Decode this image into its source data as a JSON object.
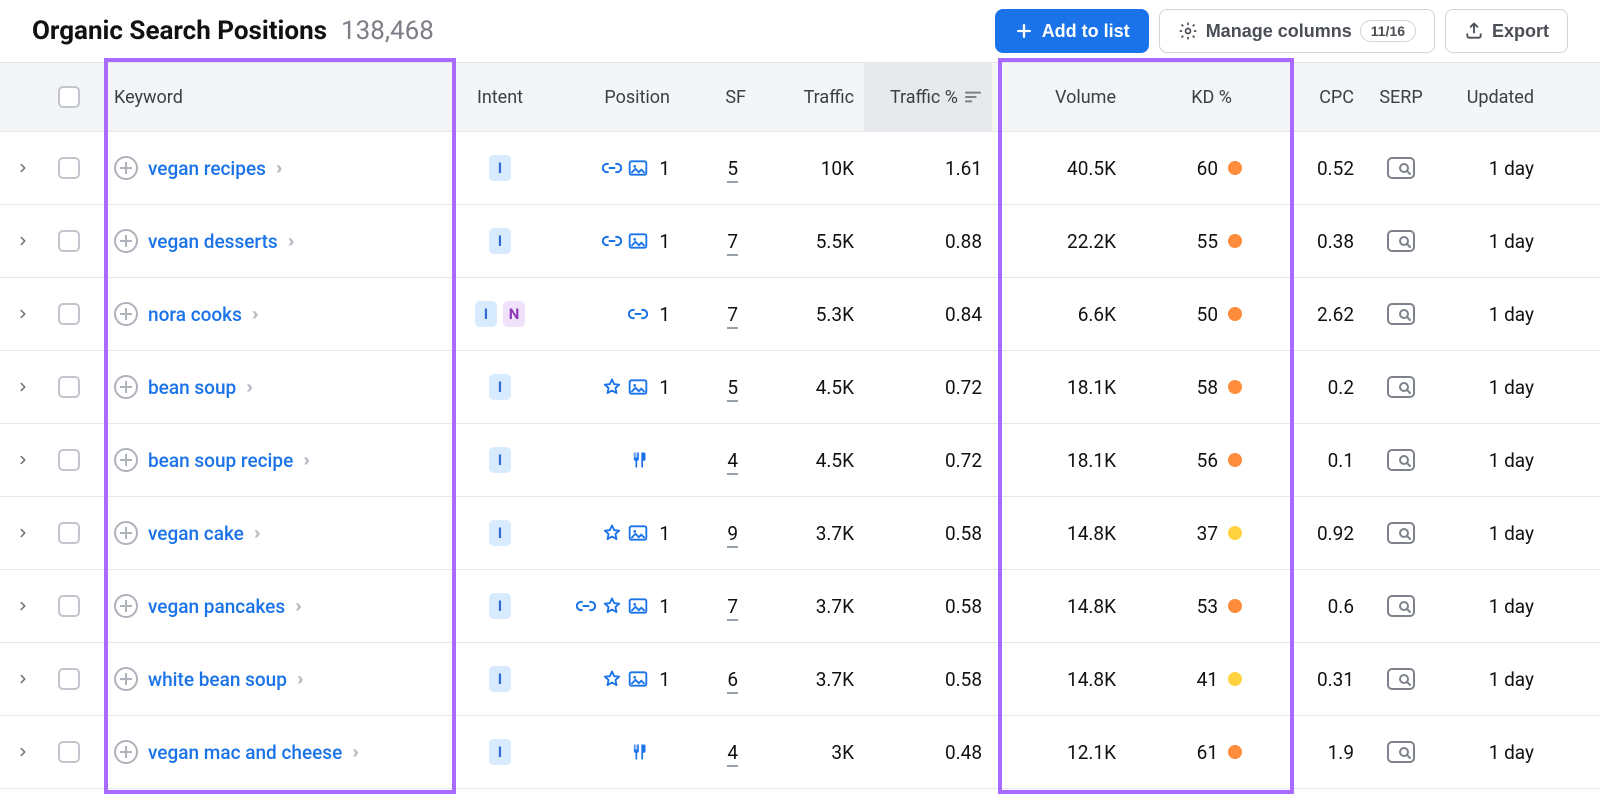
{
  "header": {
    "title": "Organic Search Positions",
    "count": "138,468",
    "add_to_list": "Add to list",
    "manage_columns": "Manage columns",
    "columns_badge": "11/16",
    "export": "Export"
  },
  "columns": {
    "keyword": "Keyword",
    "intent": "Intent",
    "position": "Position",
    "sf": "SF",
    "traffic": "Traffic",
    "traffic_pct": "Traffic %",
    "volume": "Volume",
    "kd": "KD %",
    "cpc": "CPC",
    "serp": "SERP",
    "updated": "Updated"
  },
  "rows": [
    {
      "keyword": "vegan recipes",
      "intents": [
        "I"
      ],
      "pos_icons": [
        "link",
        "image"
      ],
      "position": "1",
      "sf": "5",
      "traffic": "10K",
      "traffic_pct": "1.61",
      "volume": "40.5K",
      "kd": "60",
      "kd_color": "orange",
      "cpc": "0.52",
      "updated": "1 day"
    },
    {
      "keyword": "vegan desserts",
      "intents": [
        "I"
      ],
      "pos_icons": [
        "link",
        "image"
      ],
      "position": "1",
      "sf": "7",
      "traffic": "5.5K",
      "traffic_pct": "0.88",
      "volume": "22.2K",
      "kd": "55",
      "kd_color": "orange",
      "cpc": "0.38",
      "updated": "1 day"
    },
    {
      "keyword": "nora cooks",
      "intents": [
        "I",
        "N"
      ],
      "pos_icons": [
        "link"
      ],
      "position": "1",
      "sf": "7",
      "traffic": "5.3K",
      "traffic_pct": "0.84",
      "volume": "6.6K",
      "kd": "50",
      "kd_color": "orange",
      "cpc": "2.62",
      "updated": "1 day"
    },
    {
      "keyword": "bean soup",
      "intents": [
        "I"
      ],
      "pos_icons": [
        "star",
        "image"
      ],
      "position": "1",
      "sf": "5",
      "traffic": "4.5K",
      "traffic_pct": "0.72",
      "volume": "18.1K",
      "kd": "58",
      "kd_color": "orange",
      "cpc": "0.2",
      "updated": "1 day"
    },
    {
      "keyword": "bean soup recipe",
      "intents": [
        "I"
      ],
      "pos_icons": [
        "recipe"
      ],
      "position": "",
      "sf": "4",
      "traffic": "4.5K",
      "traffic_pct": "0.72",
      "volume": "18.1K",
      "kd": "56",
      "kd_color": "orange",
      "cpc": "0.1",
      "updated": "1 day"
    },
    {
      "keyword": "vegan cake",
      "intents": [
        "I"
      ],
      "pos_icons": [
        "star",
        "image"
      ],
      "position": "1",
      "sf": "9",
      "traffic": "3.7K",
      "traffic_pct": "0.58",
      "volume": "14.8K",
      "kd": "37",
      "kd_color": "yellow",
      "cpc": "0.92",
      "updated": "1 day"
    },
    {
      "keyword": "vegan pancakes",
      "intents": [
        "I"
      ],
      "pos_icons": [
        "link",
        "star",
        "image"
      ],
      "position": "1",
      "sf": "7",
      "traffic": "3.7K",
      "traffic_pct": "0.58",
      "volume": "14.8K",
      "kd": "53",
      "kd_color": "orange",
      "cpc": "0.6",
      "updated": "1 day"
    },
    {
      "keyword": "white bean soup",
      "intents": [
        "I"
      ],
      "pos_icons": [
        "star",
        "image"
      ],
      "position": "1",
      "sf": "6",
      "traffic": "3.7K",
      "traffic_pct": "0.58",
      "volume": "14.8K",
      "kd": "41",
      "kd_color": "yellow",
      "cpc": "0.31",
      "updated": "1 day"
    },
    {
      "keyword": "vegan mac and cheese",
      "intents": [
        "I"
      ],
      "pos_icons": [
        "recipe"
      ],
      "position": "",
      "sf": "4",
      "traffic": "3K",
      "traffic_pct": "0.48",
      "volume": "12.1K",
      "kd": "61",
      "kd_color": "orange",
      "cpc": "1.9",
      "updated": "1 day"
    }
  ]
}
